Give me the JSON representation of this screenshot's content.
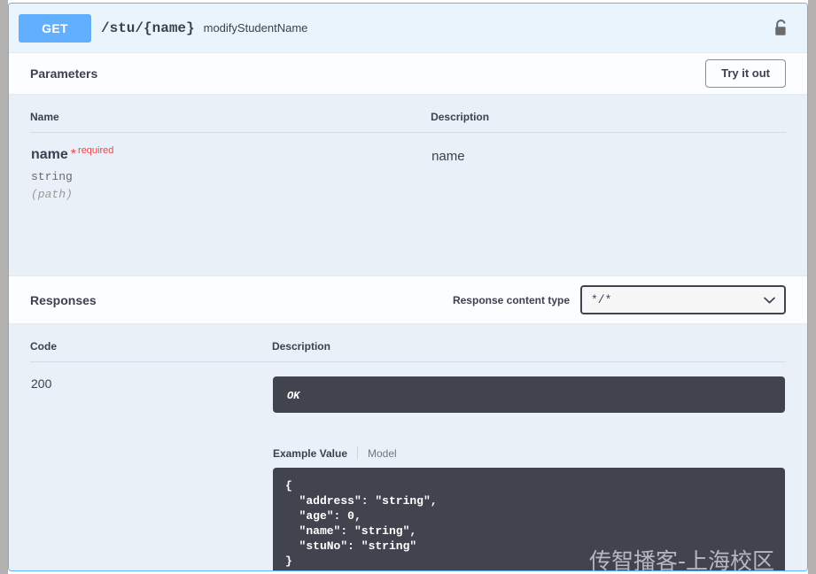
{
  "operation": {
    "method": "GET",
    "path": "/stu/{name}",
    "summary": "modifyStudentName",
    "auth_icon": "unlocked-padlock-icon",
    "method_color": "#61affe"
  },
  "parameters": {
    "section_title": "Parameters",
    "try_it_out_label": "Try it out",
    "columns": {
      "name": "Name",
      "description": "Description"
    },
    "rows": [
      {
        "name": "name",
        "required_star": "*",
        "required_label": "required",
        "type": "string",
        "in": "(path)",
        "description": "name"
      }
    ]
  },
  "responses": {
    "section_title": "Responses",
    "content_type_label": "Response content type",
    "content_type_value": "*/*",
    "content_type_options": [
      "*/*"
    ],
    "chevron_icon": "chevron-down-icon",
    "columns": {
      "code": "Code",
      "description": "Description"
    },
    "rows": [
      {
        "code": "200",
        "description": "OK",
        "tabs": {
          "example_value": "Example Value",
          "model": "Model"
        },
        "example_body": "{\n  \"address\": \"string\",\n  \"age\": 0,\n  \"name\": \"string\",\n  \"stuNo\": \"string\"\n}"
      }
    ]
  },
  "watermark": {
    "text": "传智播客-上海校区"
  },
  "colors": {
    "method_get": "#61affe",
    "border_blue": "#61affe",
    "band_blue": "#e9f0f8",
    "band_white": "#fcfdff",
    "code_bg": "#41444e",
    "required_red": "#f93e3e",
    "text_primary": "#3b4151"
  }
}
